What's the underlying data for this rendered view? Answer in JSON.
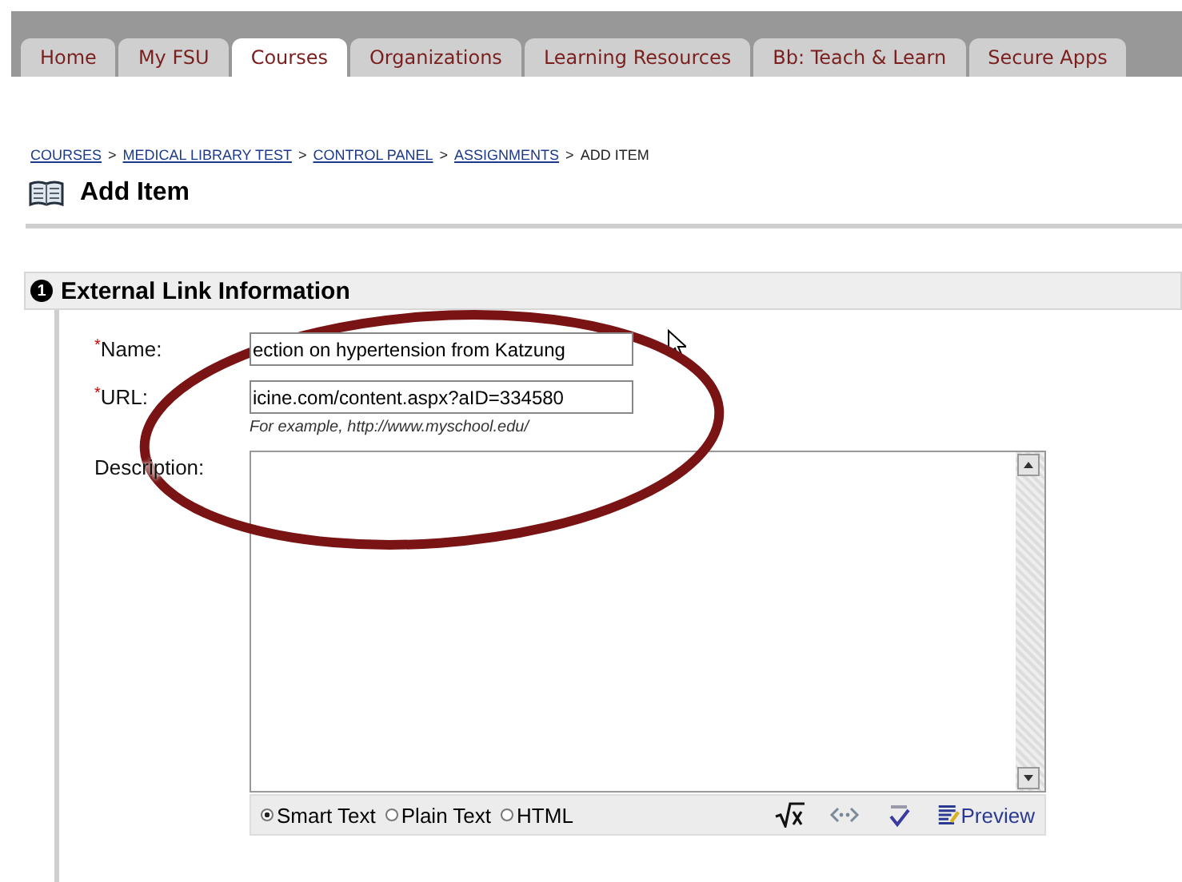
{
  "tabs": [
    {
      "label": "Home",
      "selected": false
    },
    {
      "label": "My FSU",
      "selected": false
    },
    {
      "label": "Courses",
      "selected": true
    },
    {
      "label": "Organizations",
      "selected": false
    },
    {
      "label": "Learning Resources",
      "selected": false
    },
    {
      "label": "Bb: Teach & Learn",
      "selected": false
    },
    {
      "label": "Secure Apps",
      "selected": false
    }
  ],
  "breadcrumb": [
    {
      "label": "COURSES",
      "link": true
    },
    {
      "label": "MEDICAL LIBRARY TEST",
      "link": true
    },
    {
      "label": "CONTROL PANEL",
      "link": true
    },
    {
      "label": "ASSIGNMENTS",
      "link": true
    },
    {
      "label": "ADD ITEM",
      "link": false
    }
  ],
  "breadcrumb_separator": ">",
  "page_title": "Add Item",
  "section": {
    "number": "1",
    "title": "External Link Information"
  },
  "fields": [
    {
      "label": "Name:",
      "required_mark": "*",
      "value": "ection on hypertension from Katzung"
    },
    {
      "label": "URL:",
      "required_mark": "*",
      "value": "icine.com/content.aspx?aID=334580",
      "hint": "For example, http://www.myschool.edu/"
    }
  ],
  "description": {
    "label": "Description:"
  },
  "text_modes": [
    {
      "label": "Smart Text",
      "selected": true
    },
    {
      "label": "Plain Text",
      "selected": false
    },
    {
      "label": "HTML",
      "selected": false
    }
  ],
  "preview": "Preview"
}
